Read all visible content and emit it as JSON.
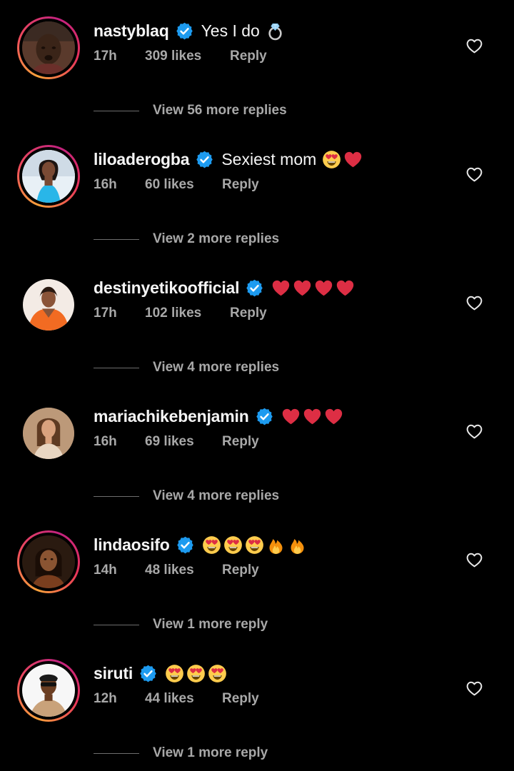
{
  "comments": [
    {
      "username": "nastyblaq",
      "text": "Yes I do",
      "emojis": [
        "ring"
      ],
      "time": "17h",
      "likes": "309 likes",
      "reply": "Reply",
      "view_more": "View 56 more replies",
      "story_ring": true
    },
    {
      "username": "liloaderogba",
      "text": "Sexiest mom",
      "emojis": [
        "heart-eyes",
        "red-heart"
      ],
      "time": "16h",
      "likes": "60 likes",
      "reply": "Reply",
      "view_more": "View 2 more replies",
      "story_ring": true
    },
    {
      "username": "destinyetikoofficial",
      "text": "",
      "emojis": [
        "red-heart",
        "red-heart",
        "red-heart",
        "red-heart"
      ],
      "time": "17h",
      "likes": "102 likes",
      "reply": "Reply",
      "view_more": "View 4 more replies",
      "story_ring": false
    },
    {
      "username": "mariachikebenjamin",
      "text": "",
      "emojis": [
        "red-heart",
        "red-heart",
        "red-heart"
      ],
      "time": "16h",
      "likes": "69 likes",
      "reply": "Reply",
      "view_more": "View 4 more replies",
      "story_ring": false
    },
    {
      "username": "lindaosifo",
      "text": "",
      "emojis": [
        "heart-eyes",
        "heart-eyes",
        "heart-eyes",
        "fire",
        "fire"
      ],
      "time": "14h",
      "likes": "48 likes",
      "reply": "Reply",
      "view_more": "View 1 more reply",
      "story_ring": true
    },
    {
      "username": "siruti",
      "text": "",
      "emojis": [
        "heart-eyes",
        "heart-eyes",
        "heart-eyes"
      ],
      "time": "12h",
      "likes": "44 likes",
      "reply": "Reply",
      "view_more": "View 1 more reply",
      "story_ring": true
    }
  ],
  "colors": {
    "background": "#000000",
    "text_primary": "#f5f5f5",
    "text_secondary": "#a8a8a8",
    "verified_blue": "#1d9bf0",
    "story_ring_gradient": [
      "#f9a13b",
      "#ef4b5c",
      "#c2227f"
    ]
  },
  "icons": {
    "verified": "verified-badge-icon",
    "like": "heart-outline-icon"
  }
}
